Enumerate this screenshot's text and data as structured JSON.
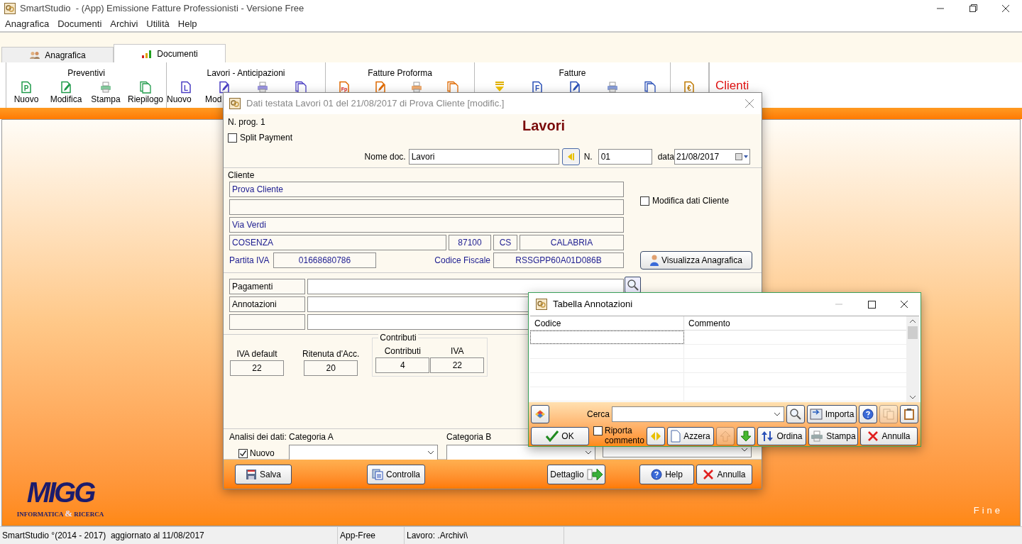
{
  "window": {
    "title": "SmartStudio  - (App) Emissione Fatture Professionisti - Versione Free"
  },
  "menu": [
    "Anagrafica",
    "Documenti",
    "Archivi",
    "Utilità",
    "Help"
  ],
  "tabs": [
    {
      "label": "Anagrafica",
      "selected": false
    },
    {
      "label": "Documenti",
      "selected": true
    }
  ],
  "ribbon": {
    "groups": [
      {
        "title": "Preventivi",
        "items": [
          {
            "kind": "letter",
            "glyph": "P",
            "label": "Nuovo"
          },
          {
            "kind": "edit",
            "label": "Modifica"
          },
          {
            "kind": "print",
            "label": "Stampa"
          },
          {
            "kind": "pages",
            "label": "Riepilogo"
          }
        ]
      },
      {
        "title": "Lavori - Anticipazioni",
        "items": [
          {
            "kind": "letter",
            "glyph": "L",
            "label": "Nuovo"
          },
          {
            "kind": "edit",
            "label": "Mod"
          },
          {
            "kind": "print"
          },
          {
            "kind": "pages"
          }
        ]
      },
      {
        "title": "Fatture Proforma",
        "items": [
          {
            "kind": "letter",
            "glyph": "Fp"
          },
          {
            "kind": "edit"
          },
          {
            "kind": "print"
          },
          {
            "kind": "pages"
          }
        ]
      },
      {
        "title": "Fatture",
        "items": [
          {
            "kind": "stack"
          },
          {
            "kind": "letter",
            "glyph": "F"
          },
          {
            "kind": "edit"
          },
          {
            "kind": "print"
          },
          {
            "kind": "pages"
          }
        ]
      },
      {
        "items": [
          {
            "kind": "letter",
            "glyph": "€"
          }
        ]
      }
    ],
    "extra": "Clienti"
  },
  "logo": {
    "name": "MIGG",
    "tagline_1": "INFORMATICA",
    "amp": "&",
    "tagline_2": "RICERCA"
  },
  "end_label": "Fine",
  "status_bar": [
    "SmartStudio °(2014 - 2017)  aggiornato al 11/08/2017",
    "App-Free",
    "Lavoro: .Archivi\\"
  ],
  "header_dialog": {
    "title": "Dati testata Lavori 01 del 21/08/2017 di Prova Cliente [modific.]",
    "prog": "N. prog. 1",
    "heading": "Lavori",
    "split_payment": {
      "label": "Split Payment",
      "checked": false
    },
    "nome_doc": {
      "label": "Nome doc.",
      "value": "Lavori"
    },
    "numero": {
      "label": "N.",
      "value": "01"
    },
    "data": {
      "label": "data",
      "value": "21/08/2017"
    },
    "cliente": {
      "legend": "Cliente",
      "name": "Prova Cliente",
      "address": "Via Verdi",
      "city": "COSENZA",
      "cap": "87100",
      "province": "CS",
      "region": "CALABRIA",
      "partita_iva": {
        "label": "Partita IVA",
        "value": "01668680786"
      },
      "codice_fiscale": {
        "label": "Codice Fiscale",
        "value": "RSSGPP60A01D086B"
      },
      "modifica": {
        "label": "Modifica dati Cliente",
        "checked": false
      },
      "visualizza_button": "Visualizza Anagrafica"
    },
    "extra_rows": [
      {
        "label": "Pagamenti"
      },
      {
        "label": "Annotazioni"
      }
    ],
    "rates": [
      {
        "label": "IVA default",
        "value": "22"
      },
      {
        "label": "Ritenuta d'Acc.",
        "value": "20"
      }
    ],
    "contributi": {
      "legend": "Contributi",
      "fields": [
        {
          "label": "Contributi",
          "value": "4"
        },
        {
          "label": "IVA",
          "value": "22"
        }
      ]
    },
    "analisi": {
      "label": "Analisi dei dati:",
      "nuovo": {
        "label": "Nuovo",
        "checked": true
      },
      "categories": [
        "Categoria A",
        "Categoria B"
      ]
    },
    "buttons": [
      "Salva",
      "Controlla",
      "Dettaglio",
      "Help",
      "Annulla"
    ]
  },
  "annotations_dialog": {
    "title": "Tabella Annotazioni",
    "columns": [
      "Codice",
      "Commento"
    ],
    "toolbar_top": [
      {
        "kind": "icon_button",
        "disabled": false
      },
      {
        "kind": "search",
        "label": "Cerca",
        "disabled": false
      },
      {
        "kind": "icon_button",
        "disabled": false
      },
      {
        "kind": "button",
        "label": "Importa",
        "disabled": false
      },
      {
        "kind": "icon_button",
        "disabled": false
      },
      {
        "kind": "icon_button",
        "disabled": true
      },
      {
        "kind": "icon_button",
        "disabled": false
      }
    ],
    "toolbar_bottom": [
      {
        "kind": "button",
        "label": "OK",
        "disabled": false
      },
      {
        "kind": "checkbox",
        "label": "Riporta commento",
        "checked": false,
        "disabled": false
      },
      {
        "kind": "icon_button",
        "disabled": false
      },
      {
        "kind": "button",
        "label": "Azzera",
        "disabled": false
      },
      {
        "kind": "icon_button",
        "disabled": true
      },
      {
        "kind": "icon_button",
        "disabled": false
      },
      {
        "kind": "button",
        "label": "Ordina",
        "disabled": false
      },
      {
        "kind": "button",
        "label": "Stampa",
        "disabled": false
      },
      {
        "kind": "button",
        "label": "Annulla",
        "disabled": false
      }
    ]
  }
}
